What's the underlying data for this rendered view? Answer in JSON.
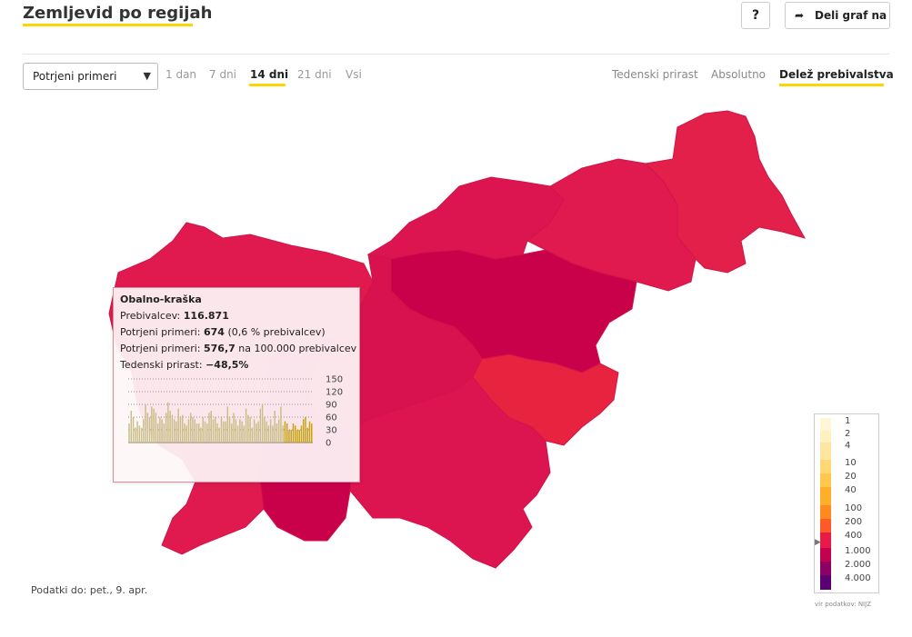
{
  "header": {
    "title": "Zemljevid po regijah",
    "help_label": "?",
    "share_label": "Deli graf na"
  },
  "controls": {
    "metric_select": "Potrjeni primeri",
    "ranges": [
      "1 dan",
      "7 dni",
      "14 dni",
      "21 dni",
      "Vsi"
    ],
    "active_range": "14 dni",
    "modes": [
      "Tedenski prirast",
      "Absolutno",
      "Delež prebivalstva"
    ],
    "active_mode": "Delež prebivalstva"
  },
  "colors": {
    "accent": "#ffd400",
    "region_main": "#e01a4f",
    "region_dark": "#c9004a",
    "region_light": "#e8213f"
  },
  "tooltip": {
    "region": "Obalno-kraška",
    "population_label": "Prebivalcev:",
    "population": "116.871",
    "confirmed_label": "Potrjeni primeri:",
    "confirmed": "674",
    "confirmed_pct": "(0,6 % prebivalcev)",
    "per100k_label": "Potrjeni primeri:",
    "per100k": "576,7",
    "per100k_suffix": "na 100.000 prebivalcev",
    "growth_label": "Tedenski prirast:",
    "growth": "−48,5%",
    "chart_ticks": [
      "150",
      "120",
      "90",
      "60",
      "30",
      "0"
    ]
  },
  "chart_data": {
    "type": "bar",
    "ylim": [
      0,
      150
    ],
    "y_ticks": [
      0,
      30,
      60,
      90,
      120,
      150
    ],
    "values": [
      45,
      75,
      60,
      35,
      50,
      40,
      35,
      55,
      90,
      70,
      60,
      85,
      80,
      70,
      45,
      60,
      55,
      45,
      70,
      95,
      75,
      65,
      55,
      50,
      80,
      60,
      65,
      45,
      40,
      55,
      70,
      60,
      55,
      45,
      45,
      35,
      60,
      50,
      45,
      70,
      75,
      55,
      60,
      45,
      35,
      60,
      50,
      50,
      85,
      60,
      45,
      70,
      55,
      40,
      55,
      50,
      40,
      80,
      65,
      60,
      35,
      55,
      45,
      50,
      80,
      90,
      60,
      50,
      40,
      55,
      40,
      75,
      45,
      55,
      85,
      40,
      50,
      45,
      30,
      30,
      45,
      40,
      30,
      30,
      40,
      55,
      60,
      35,
      50,
      45
    ]
  },
  "legend": {
    "labels": [
      "1",
      "2",
      "4",
      "10",
      "20",
      "40",
      "100",
      "200",
      "400",
      "1.000",
      "2.000",
      "4.000"
    ],
    "colors": [
      "#fff6d8",
      "#fff0c0",
      "#ffe6a0",
      "#ffd773",
      "#ffc84d",
      "#ffae2a",
      "#ff8a1f",
      "#ff5a28",
      "#e81a48",
      "#c1004f",
      "#8c0066",
      "#5a0072"
    ],
    "source": "vir podatkov: NIJZ"
  },
  "footer": "Podatki do: pet., 9. apr."
}
